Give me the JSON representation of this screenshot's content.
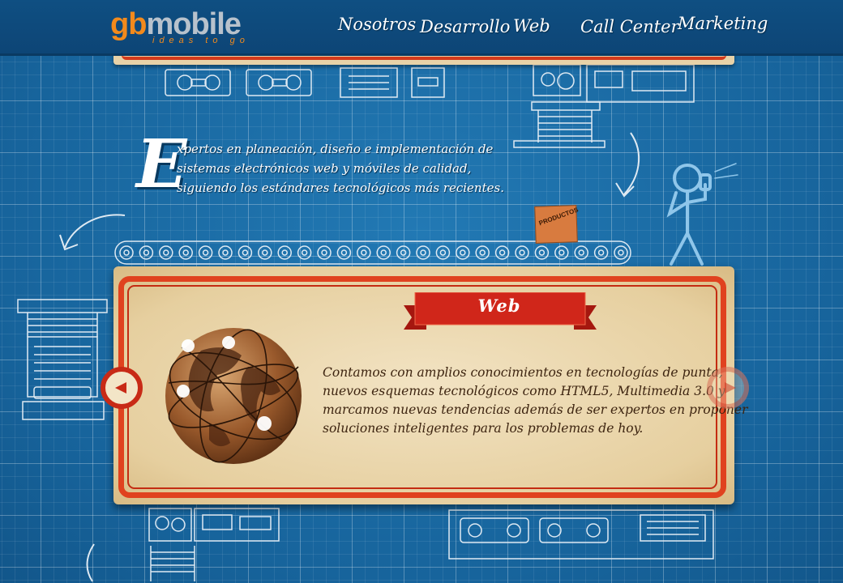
{
  "brand": {
    "logo_prefix": "gb",
    "logo_suffix": "mobile",
    "tagline": "ideas to go"
  },
  "nav": {
    "items": [
      "Nosotros",
      "Desarrollo",
      "Web",
      "Call Center",
      "Marketing"
    ]
  },
  "intro": {
    "drop_cap": "E",
    "lines": [
      "xpertos en planeación, diseño e implementación de",
      "sistemas electrónicos web y móviles de calidad,",
      "siguiendo los estándares tecnológicos más recientes."
    ]
  },
  "box_label": "PRODUCTOS",
  "slide": {
    "title": "Web",
    "body_lines": [
      "Contamos con amplios conocimientos en tecnologías de punta,",
      "nuevos esquemas tecnológicos como HTML5, Multimedia 3.0 y",
      "marcamos nuevas tendencias además de ser expertos en proponer",
      "soluciones inteligentes para los problemas de hoy."
    ]
  },
  "colors": {
    "accent_orange": "#f28a1c",
    "ribbon_red": "#d0261a",
    "frame_red": "#e0421f",
    "blueprint": "#1a6da8"
  }
}
